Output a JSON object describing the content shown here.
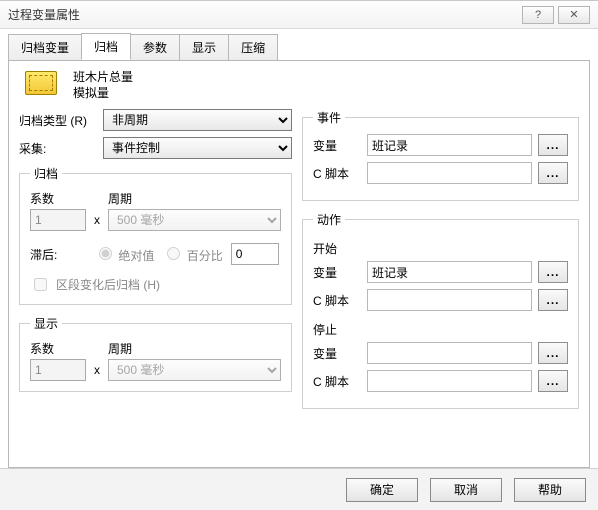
{
  "window": {
    "title": "过程变量属性",
    "help_hint": "?",
    "close_hint": "✕"
  },
  "tabs": {
    "gdbl": "归档变量",
    "gd": "归档",
    "cs": "参数",
    "xs": "显示",
    "ys": "压缩"
  },
  "header": {
    "line1": "班木片总量",
    "line2": "模拟量"
  },
  "left": {
    "archive_type_label": "归档类型 (R)",
    "archive_type_value": "非周期",
    "acquisition_label": "采集:",
    "acquisition_value": "事件控制",
    "gd_group": "归档",
    "xs_group": "显示",
    "coef_label": "系数",
    "period_label": "周期",
    "mult": "x",
    "coef_value": "1",
    "period_value": "500 毫秒",
    "lag_label": "滞后:",
    "radio_abs": "绝对值",
    "radio_pct": "百分比",
    "pct_value": "0",
    "chk_label": "区段变化后归档 (H)"
  },
  "right": {
    "events_group": "事件",
    "actions_group": "动作",
    "var_label": "变量",
    "script_label": "C 脚本",
    "start_label": "开始",
    "stop_label": "停止",
    "var_value": "班记录",
    "browse": "..."
  },
  "footer": {
    "ok": "确定",
    "cancel": "取消",
    "help": "帮助"
  }
}
